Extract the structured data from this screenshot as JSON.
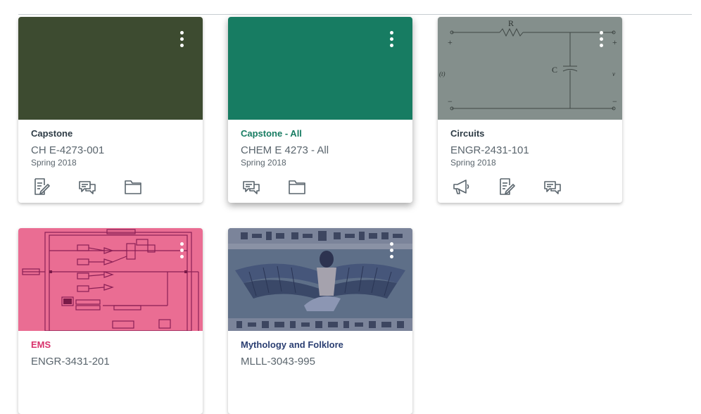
{
  "colors": {
    "capstone_hero": "#3d4b30",
    "capstone_all_hero": "#177c62",
    "circuits_hero": "#848f8c",
    "ems_hero": "#ea6d93",
    "mythology_hero": "#5e6f88",
    "title_dark": "#2d3b45",
    "title_green": "#177c62",
    "title_pink": "#d8326c",
    "title_blue": "#2b3f72",
    "meta_gray": "#5a656d",
    "icon_gray": "#5a656d"
  },
  "cards": [
    {
      "title": "Capstone",
      "code": "CH E-4273-001",
      "term": "Spring 2018",
      "icons": [
        "assignments-icon",
        "discussions-icon",
        "files-icon"
      ]
    },
    {
      "title": "Capstone - All",
      "code": "CHEM E 4273 - All",
      "term": "Spring 2018",
      "icons": [
        "discussions-icon",
        "files-icon"
      ]
    },
    {
      "title": "Circuits",
      "code": "ENGR-2431-101",
      "term": "Spring 2018",
      "icons": [
        "announcements-icon",
        "assignments-icon",
        "discussions-icon"
      ]
    },
    {
      "title": "EMS",
      "code": "ENGR-3431-201"
    },
    {
      "title": "Mythology and Folklore",
      "code": "MLLL-3043-995"
    }
  ],
  "circuit_labels": {
    "resistor": "R",
    "capacitor": "C",
    "plus": "+",
    "minus": "−",
    "input": "(t)",
    "output": "v"
  }
}
